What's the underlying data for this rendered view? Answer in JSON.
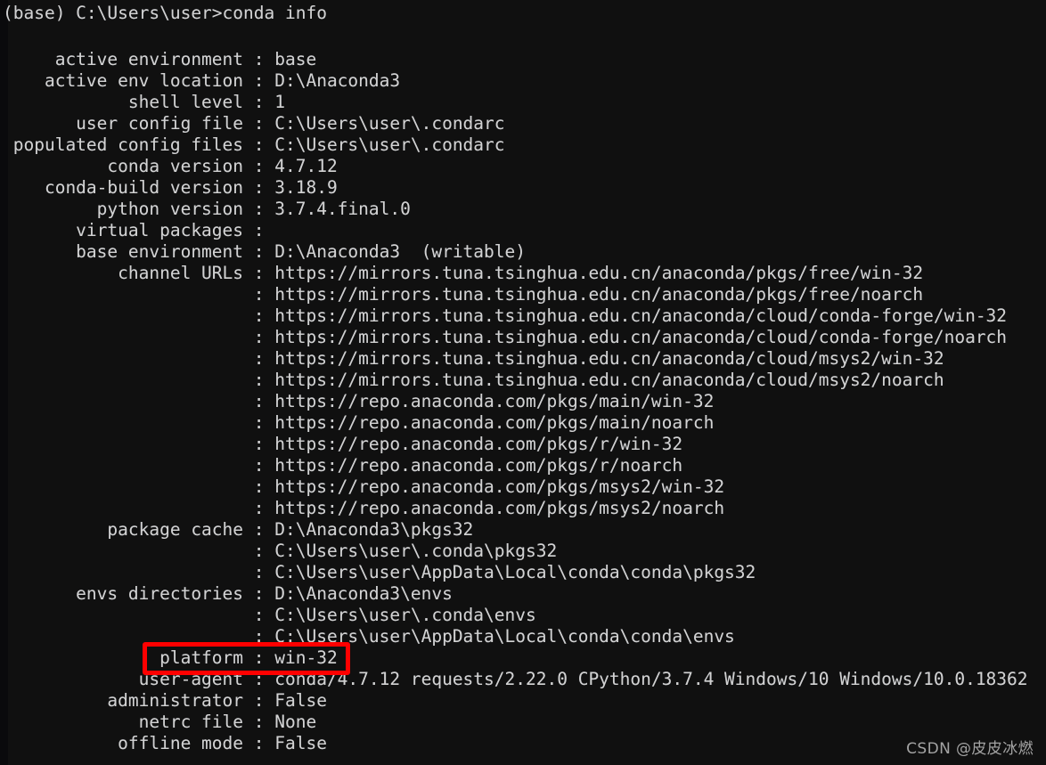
{
  "terminal": {
    "background_color": "#101010",
    "text_color": "#d2d2d2",
    "prompt": "(base) C:\\Users\\user>conda info",
    "prompt_env": "(base)",
    "prompt_path": "C:\\Users\\user",
    "command": "conda info"
  },
  "info": {
    "rows": [
      {
        "label": "active environment",
        "value": "base"
      },
      {
        "label": "active env location",
        "value": "D:\\Anaconda3"
      },
      {
        "label": "shell level",
        "value": "1"
      },
      {
        "label": "user config file",
        "value": "C:\\Users\\user\\.condarc"
      },
      {
        "label": "populated config files",
        "value": "C:\\Users\\user\\.condarc"
      },
      {
        "label": "conda version",
        "value": "4.7.12"
      },
      {
        "label": "conda-build version",
        "value": "3.18.9"
      },
      {
        "label": "python version",
        "value": "3.7.4.final.0"
      },
      {
        "label": "virtual packages",
        "value": ""
      },
      {
        "label": "base environment",
        "value": "D:\\Anaconda3  (writable)"
      },
      {
        "label": "channel URLs",
        "value": "https://mirrors.tuna.tsinghua.edu.cn/anaconda/pkgs/free/win-32"
      },
      {
        "label": "",
        "value": "https://mirrors.tuna.tsinghua.edu.cn/anaconda/pkgs/free/noarch"
      },
      {
        "label": "",
        "value": "https://mirrors.tuna.tsinghua.edu.cn/anaconda/cloud/conda-forge/win-32"
      },
      {
        "label": "",
        "value": "https://mirrors.tuna.tsinghua.edu.cn/anaconda/cloud/conda-forge/noarch"
      },
      {
        "label": "",
        "value": "https://mirrors.tuna.tsinghua.edu.cn/anaconda/cloud/msys2/win-32"
      },
      {
        "label": "",
        "value": "https://mirrors.tuna.tsinghua.edu.cn/anaconda/cloud/msys2/noarch"
      },
      {
        "label": "",
        "value": "https://repo.anaconda.com/pkgs/main/win-32"
      },
      {
        "label": "",
        "value": "https://repo.anaconda.com/pkgs/main/noarch"
      },
      {
        "label": "",
        "value": "https://repo.anaconda.com/pkgs/r/win-32"
      },
      {
        "label": "",
        "value": "https://repo.anaconda.com/pkgs/r/noarch"
      },
      {
        "label": "",
        "value": "https://repo.anaconda.com/pkgs/msys2/win-32"
      },
      {
        "label": "",
        "value": "https://repo.anaconda.com/pkgs/msys2/noarch"
      },
      {
        "label": "package cache",
        "value": "D:\\Anaconda3\\pkgs32"
      },
      {
        "label": "",
        "value": "C:\\Users\\user\\.conda\\pkgs32"
      },
      {
        "label": "",
        "value": "C:\\Users\\user\\AppData\\Local\\conda\\conda\\pkgs32"
      },
      {
        "label": "envs directories",
        "value": "D:\\Anaconda3\\envs"
      },
      {
        "label": "",
        "value": "C:\\Users\\user\\.conda\\envs"
      },
      {
        "label": "",
        "value": "C:\\Users\\user\\AppData\\Local\\conda\\conda\\envs"
      },
      {
        "label": "platform",
        "value": "win-32"
      },
      {
        "label": "user-agent",
        "value": "conda/4.7.12 requests/2.22.0 CPython/3.7.4 Windows/10 Windows/10.0.18362"
      },
      {
        "label": "administrator",
        "value": "False"
      },
      {
        "label": "netrc file",
        "value": "None"
      },
      {
        "label": "offline mode",
        "value": "False"
      }
    ],
    "label_column_width": 23,
    "separator": " : "
  },
  "annotation": {
    "highlight_target_label": "platform",
    "highlight_target_value": "win-32",
    "highlight_color": "#ff0000"
  },
  "watermark": {
    "text": "CSDN @皮皮冰燃"
  }
}
